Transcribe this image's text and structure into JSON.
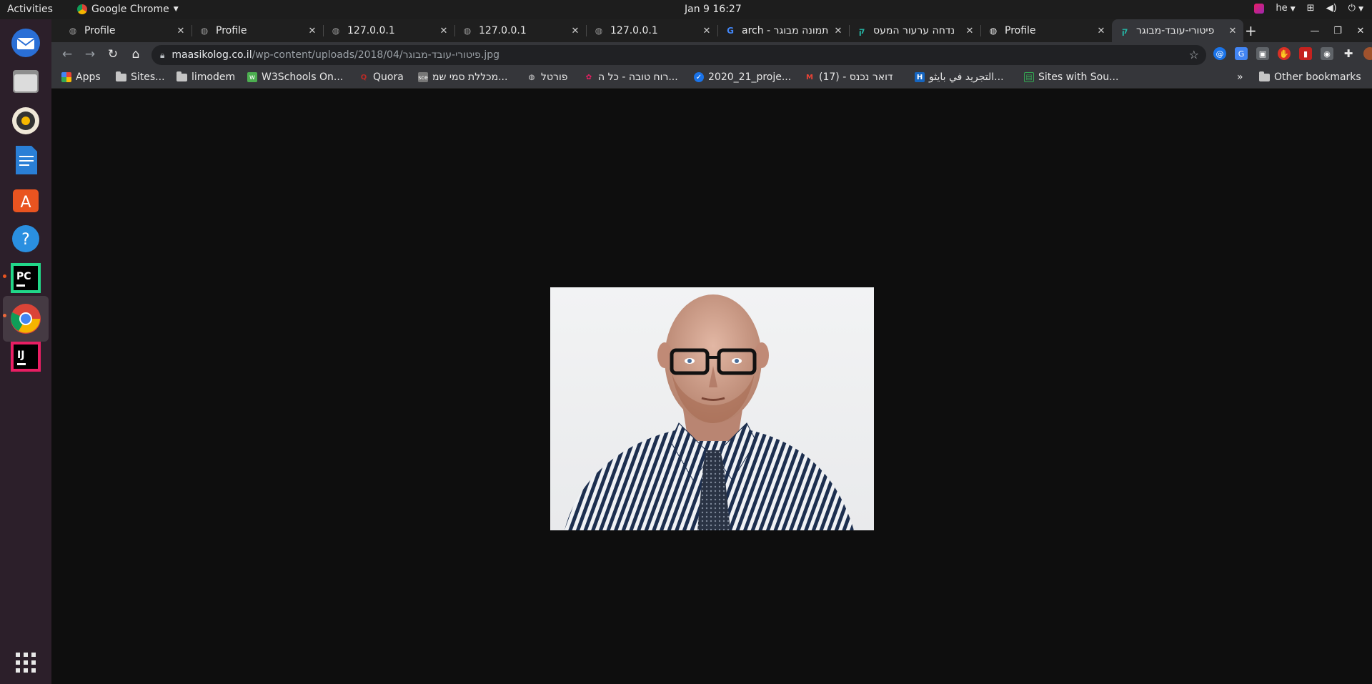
{
  "topbar": {
    "activities": "Activities",
    "app_name": "Google Chrome",
    "clock": "Jan 9  16:27",
    "input_lang": "he"
  },
  "dock": {
    "items": [
      "thunderbird",
      "files",
      "rhythmbox",
      "libreoffice-writer",
      "ubuntu-software",
      "help",
      "pycharm",
      "google-chrome",
      "intellij-idea"
    ],
    "active": "google-chrome"
  },
  "tabs": [
    {
      "title": "Profile",
      "icon": "globe-icon"
    },
    {
      "title": "Profile",
      "icon": "globe-icon"
    },
    {
      "title": "127.0.0.1",
      "icon": "globe-icon"
    },
    {
      "title": "127.0.0.1",
      "icon": "globe-icon"
    },
    {
      "title": "127.0.0.1",
      "icon": "globe-icon"
    },
    {
      "title": "תמונה מבוגר - arch",
      "icon": "google-icon"
    },
    {
      "title": "נדחה ערעור המעס",
      "icon": "site-icon"
    },
    {
      "title": "Profile",
      "icon": "globe-icon"
    },
    {
      "title": "פיטורי-עובד-מבוגר",
      "icon": "site-icon",
      "active": true
    }
  ],
  "address_bar": {
    "host": "maasikolog.co.il",
    "path": "/wp-content/uploads/2018/04/פיטורי-עובד-מבוגר.jpg"
  },
  "bookmarks": [
    {
      "label": "Apps",
      "icon": "apps-grid-icon"
    },
    {
      "label": "Sites...",
      "icon": "folder-icon"
    },
    {
      "label": "limodem",
      "icon": "folder-icon"
    },
    {
      "label": "W3Schools On...",
      "icon": "w3schools-icon"
    },
    {
      "label": "Quora",
      "icon": "quora-icon"
    },
    {
      "label": "מכללת סמי שמ...",
      "icon": "sce-icon"
    },
    {
      "label": "פורטל",
      "icon": "globe-icon"
    },
    {
      "label": "רוח טובה - כל ה...",
      "icon": "flower-icon"
    },
    {
      "label": "2020_21_proje...",
      "icon": "check-icon"
    },
    {
      "label": "דואר נכנס - (17)",
      "icon": "gmail-icon"
    },
    {
      "label": "التجريد في بايثو...",
      "icon": "h-icon"
    },
    {
      "label": "Sites with Sou...",
      "icon": "sites-icon"
    }
  ],
  "other_bookmarks": "Other bookmarks",
  "overflow": "»",
  "image": {
    "alt": "Bald man with glasses wearing a striped shirt and tie"
  }
}
